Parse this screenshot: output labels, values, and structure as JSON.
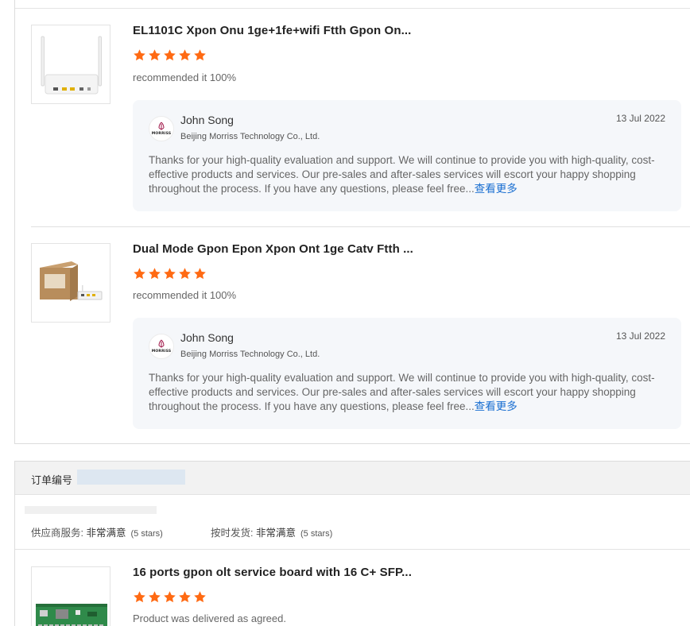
{
  "colors": {
    "star": "#ff6a13",
    "link": "#1a6fd1",
    "reply_bg": "#f5f7fa"
  },
  "products": [
    {
      "title": "EL1101C Xpon Onu 1ge+1fe+wifi Ftth Gpon On...",
      "rating": 5,
      "review": "recommended it 100%",
      "image_icon": "router-image",
      "reply": {
        "name": "John Song",
        "company": "Beijing Morriss Technology Co., Ltd.",
        "date": "13 Jul 2022",
        "body": "Thanks for your high-quality evaluation and support. We will continue to provide you with high-quality, cost-effective products and services. Our pre-sales and after-sales services will escort your happy shopping throughout the process. If you have any questions, please feel free...",
        "more": "查看更多",
        "logo_text": "MORRISS"
      }
    },
    {
      "title": "Dual Mode Gpon Epon Xpon Ont 1ge Catv Ftth ...",
      "rating": 5,
      "review": "recommended it 100%",
      "image_icon": "ont-box-image",
      "reply": {
        "name": "John Song",
        "company": "Beijing Morriss Technology Co., Ltd.",
        "date": "13 Jul 2022",
        "body": "Thanks for your high-quality evaluation and support. We will continue to provide you with high-quality, cost-effective products and services. Our pre-sales and after-sales services will escort your happy shopping throughout the process. If you have any questions, please feel free...",
        "more": "查看更多",
        "logo_text": "MORRISS"
      }
    }
  ],
  "order": {
    "number_label": "订单编号",
    "supplier_service": {
      "label": "供应商服务:",
      "value": "非常满意",
      "stars": "(5 stars)"
    },
    "on_time": {
      "label": "按时发货:",
      "value": "非常满意",
      "stars": "(5 stars)"
    },
    "product": {
      "title": "16 ports gpon olt service board with 16 C+ SFP...",
      "rating": 5,
      "review": "Product was delivered as agreed.",
      "image_icon": "olt-board-image"
    }
  }
}
